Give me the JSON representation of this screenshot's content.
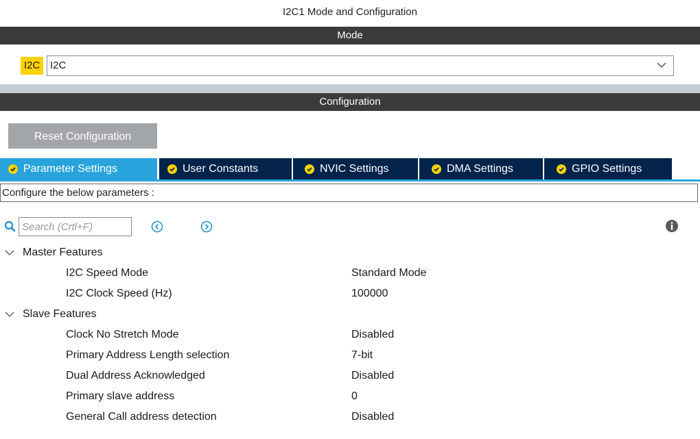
{
  "window_title": "I2C1 Mode and Configuration",
  "mode_section": {
    "header": "Mode",
    "tag": "I2C",
    "selected_value": "I2C"
  },
  "config_section": {
    "header": "Configuration",
    "reset_label": "Reset Configuration"
  },
  "tabs": [
    {
      "label": "Parameter Settings",
      "active": true
    },
    {
      "label": "User Constants",
      "active": false
    },
    {
      "label": "NVIC Settings",
      "active": false
    },
    {
      "label": "DMA Settings",
      "active": false
    },
    {
      "label": "GPIO Settings",
      "active": false
    }
  ],
  "configure_text": "Configure the below parameters :",
  "search": {
    "placeholder": "Search (Crtl+F)"
  },
  "groups": [
    {
      "name": "Master Features",
      "params": [
        {
          "name": "I2C Speed Mode",
          "value": "Standard Mode"
        },
        {
          "name": "I2C Clock Speed (Hz)",
          "value": "100000"
        }
      ]
    },
    {
      "name": "Slave Features",
      "params": [
        {
          "name": "Clock No Stretch Mode",
          "value": "Disabled"
        },
        {
          "name": "Primary Address Length selection",
          "value": "7-bit"
        },
        {
          "name": "Dual Address Acknowledged",
          "value": "Disabled"
        },
        {
          "name": "Primary slave address",
          "value": "0"
        },
        {
          "name": "General Call address detection",
          "value": "Disabled"
        }
      ]
    }
  ],
  "colors": {
    "header_bar": "#3b3b3b",
    "tab_active": "#29a3dc",
    "tab_inactive": "#03234b",
    "check_badge": "#ffd200",
    "mode_tag": "#ffd200",
    "reset_button": "#a3a6a9"
  },
  "icons": {
    "search": "search-icon",
    "prev": "chevron-left-circle-icon",
    "next": "chevron-right-circle-icon",
    "info": "info-icon",
    "tab_status": "check-circle-icon",
    "expand": "chevron-down-icon"
  }
}
